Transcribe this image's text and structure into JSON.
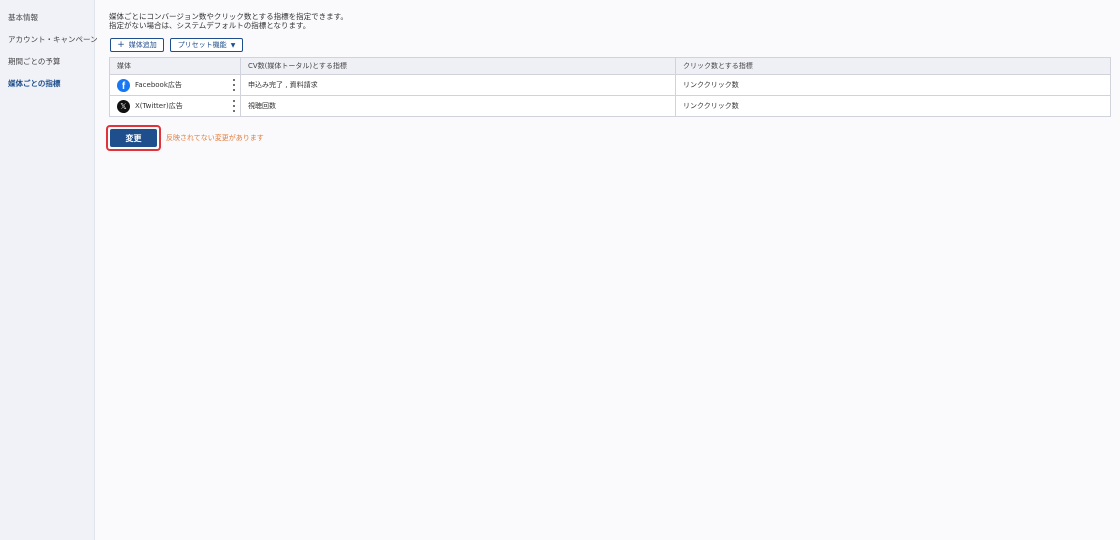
{
  "sidebar": {
    "items": [
      {
        "label": "基本情報",
        "active": false
      },
      {
        "label": "アカウント・キャンペーン",
        "active": false
      },
      {
        "label": "期間ごとの予算",
        "active": false
      },
      {
        "label": "媒体ごとの指標",
        "active": true
      }
    ]
  },
  "main": {
    "description": [
      "媒体ごとにコンバージョン数やクリック数とする指標を指定できます。",
      "指定がない場合は、システムデフォルトの指標となります。"
    ],
    "buttons": {
      "add_media": "媒体追加",
      "preset": "プリセット機能"
    },
    "table": {
      "headers": [
        "媒体",
        "CV数(媒体トータル)とする指標",
        "クリック数とする指標"
      ],
      "rows": [
        {
          "media": "Facebook広告",
          "icon": "facebook-icon",
          "cv_metric": "申込み完了 , 資料請求",
          "click_metric": "リンククリック数"
        },
        {
          "media": "X(Twitter)広告",
          "icon": "x-twitter-icon",
          "cv_metric": "視聴回数",
          "click_metric": "リンククリック数"
        }
      ]
    },
    "submit_label": "変更",
    "unsaved_notice": "反映されてない変更があります"
  },
  "colors": {
    "accent": "#1f4e8c",
    "warning": "#e07b3c",
    "highlight_border": "#e0323a",
    "facebook": "#1877f2"
  }
}
